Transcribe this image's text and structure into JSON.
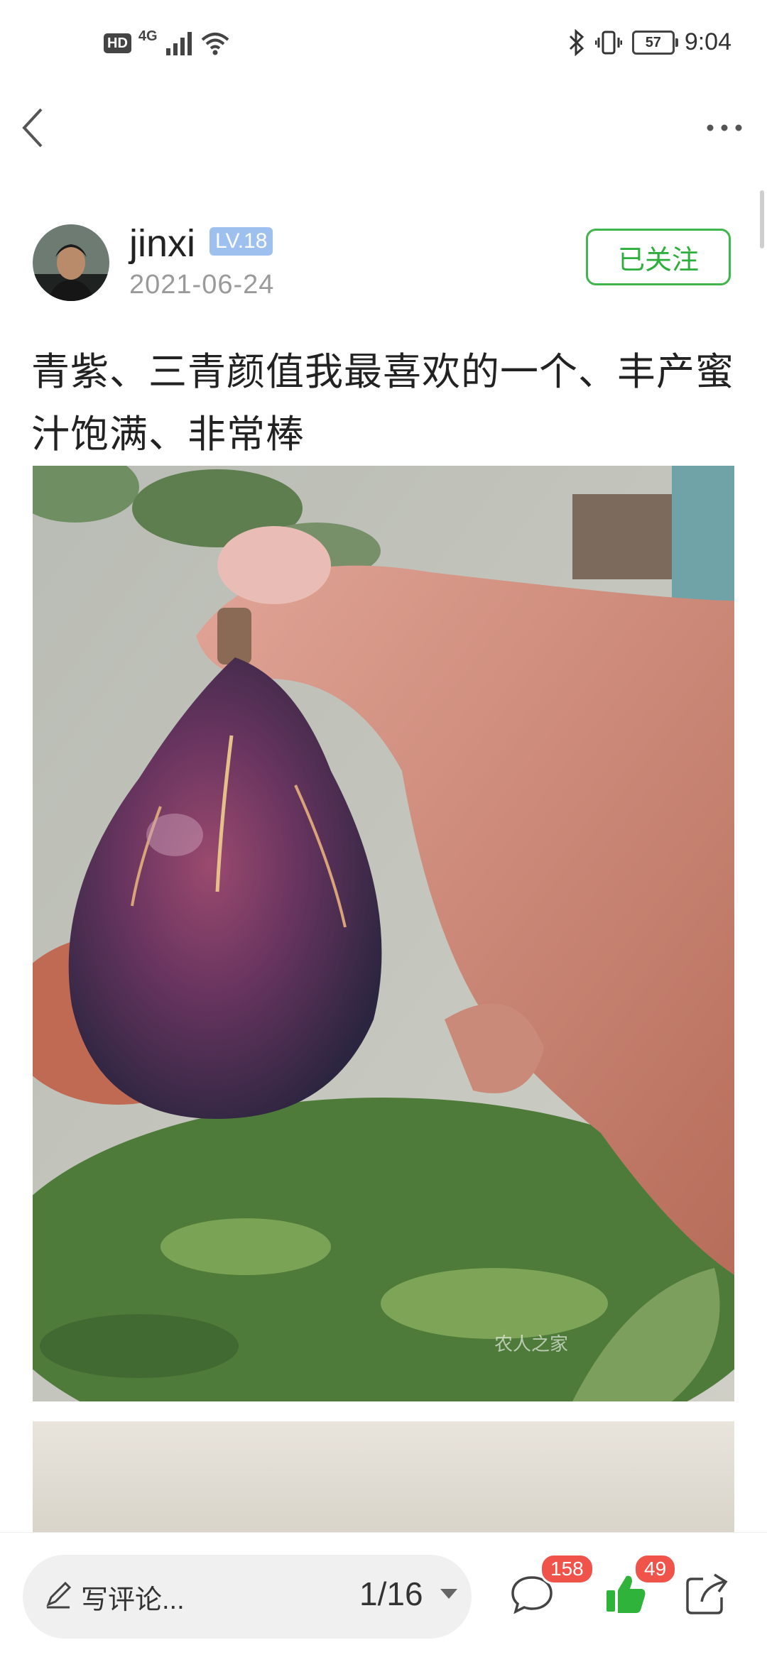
{
  "status_bar": {
    "hd": "HD",
    "network": "4G",
    "battery": "57",
    "time": "9:04"
  },
  "post": {
    "author": {
      "name": "jinxi",
      "level": "LV.18",
      "date": "2021-06-24",
      "follow_label": "已关注"
    },
    "title": "青紫、三青颜值我最喜欢的一个、丰产蜜汁饱满、非常棒",
    "watermark": "农人之家"
  },
  "bottom_bar": {
    "comment_placeholder": "写评论...",
    "pager": "1/16",
    "comments_count": "158",
    "likes_count": "49"
  },
  "colors": {
    "accent_green": "#3fb54b",
    "badge_red": "#f0534a",
    "level_blue": "#9ec0ee"
  }
}
